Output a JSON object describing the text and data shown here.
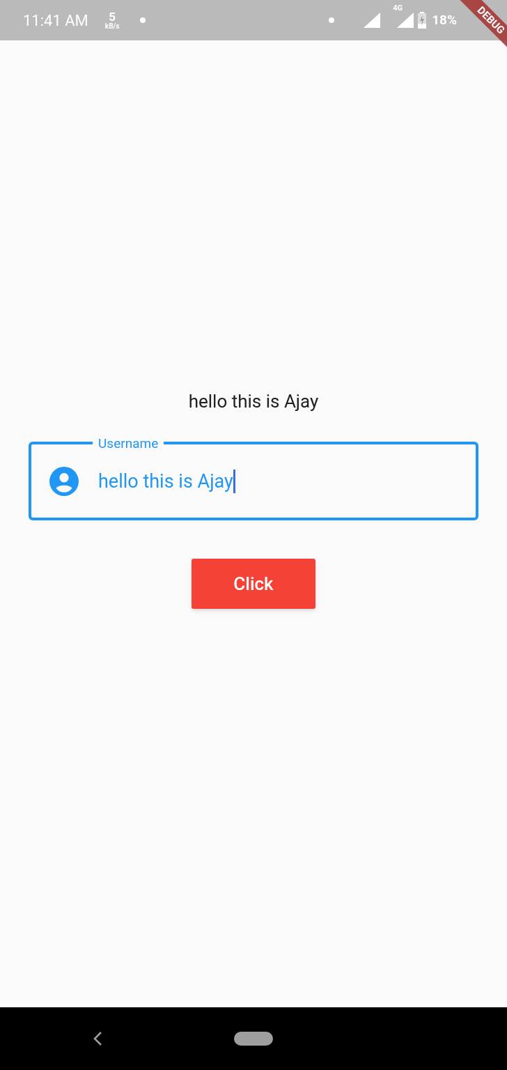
{
  "status_bar": {
    "time": "11:41 AM",
    "speed_value": "5",
    "speed_unit": "kB/s",
    "network_label": "4G",
    "battery": "18%",
    "charging": true
  },
  "debug_banner": {
    "label": "DEBUG"
  },
  "greeting": "hello this is Ajay",
  "username_field": {
    "label": "Username",
    "value": "hello this is Ajay",
    "focused": true
  },
  "button": {
    "label": "Click"
  }
}
